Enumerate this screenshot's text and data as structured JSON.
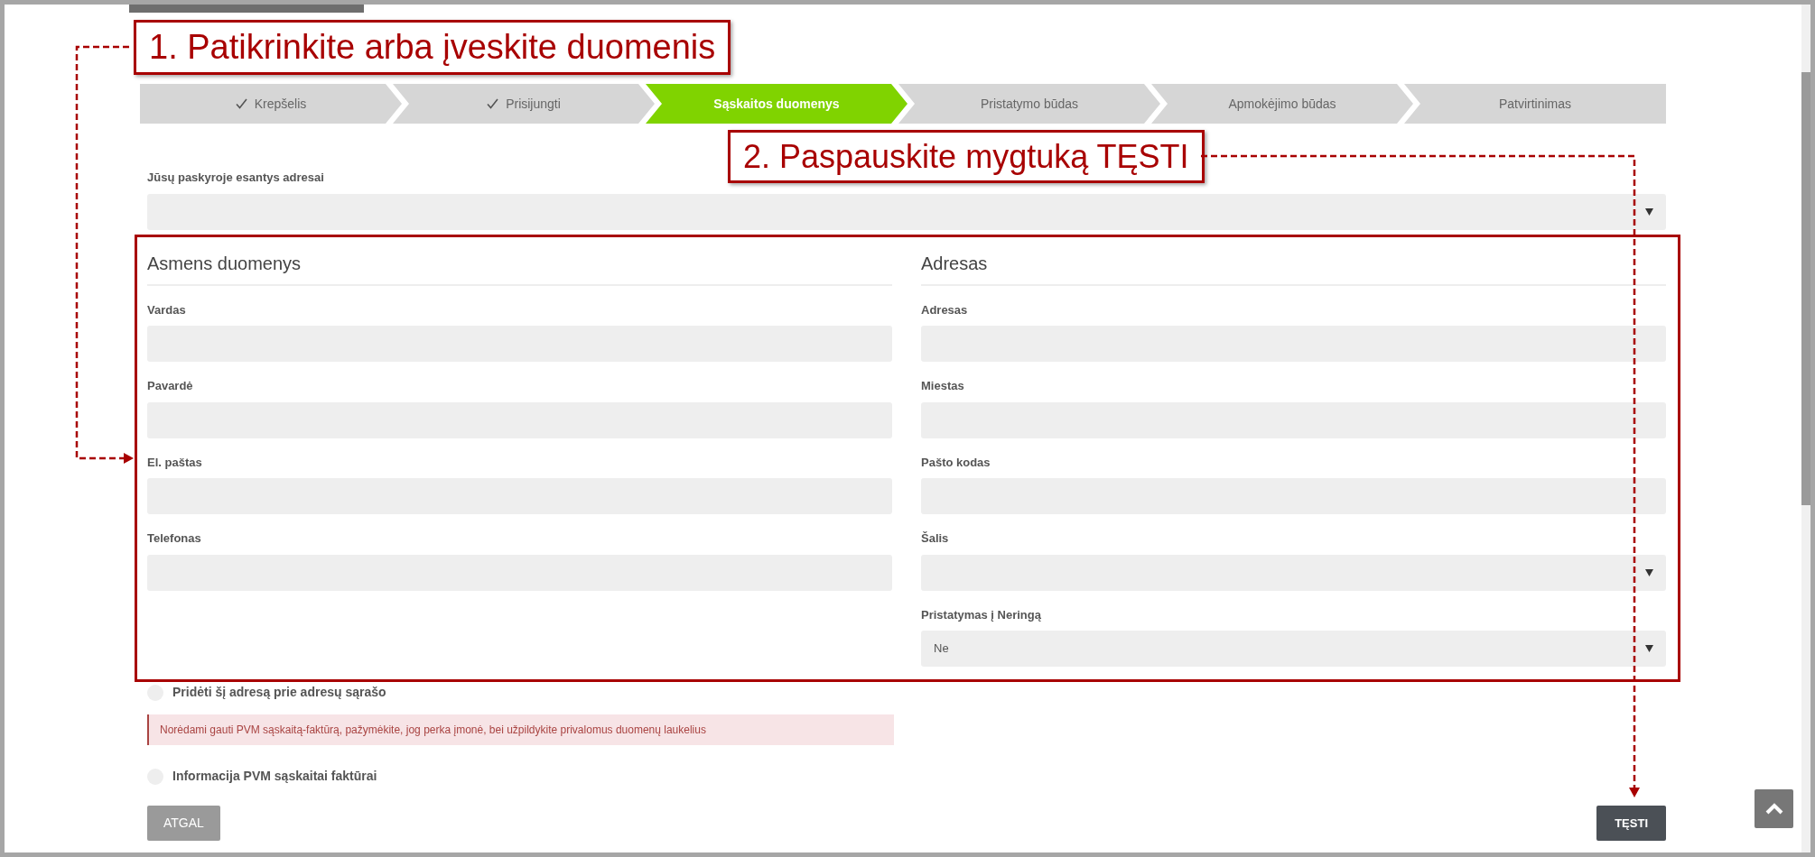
{
  "annotations": [
    {
      "text": "1. Patikrinkite arba įveskite duomenis"
    },
    {
      "text": "2. Paspauskite mygtuką TĘSTI"
    }
  ],
  "steps": [
    {
      "label": "Krepšelis",
      "done": true,
      "selected": false
    },
    {
      "label": "Prisijungti",
      "done": true,
      "selected": false
    },
    {
      "label": "Sąskaitos duomenys",
      "done": false,
      "selected": true
    },
    {
      "label": "Pristatymo būdas",
      "done": false,
      "selected": false
    },
    {
      "label": "Apmokėjimo būdas",
      "done": false,
      "selected": false
    },
    {
      "label": "Patvirtinimas",
      "done": false,
      "selected": false
    }
  ],
  "saved_addresses": {
    "label": "Jūsų paskyroje esantys adresai",
    "kind": "select"
  },
  "columns": [
    {
      "heading": "Asmens duomenys",
      "fields": [
        {
          "label": "Vardas",
          "kind": "text"
        },
        {
          "label": "Pavardė",
          "kind": "text"
        },
        {
          "label": "El. paštas",
          "kind": "text"
        },
        {
          "label": "Telefonas",
          "kind": "text"
        }
      ]
    },
    {
      "heading": "Adresas",
      "fields": [
        {
          "label": "Adresas",
          "kind": "text"
        },
        {
          "label": "Miestas",
          "kind": "text"
        },
        {
          "label": "Pašto kodas",
          "kind": "text"
        },
        {
          "label": "Šalis",
          "kind": "select"
        },
        {
          "label": "Pristatymas į Neringą",
          "kind": "select",
          "value": "Ne"
        }
      ]
    }
  ],
  "add_address": {
    "label": "Pridėti šį adresą prie adresų sąrašo",
    "checked": false
  },
  "notice": "Norėdami gauti PVM sąskaitą-faktūrą, pažymėkite, jog perka įmonė, bei užpildykite privalomus duomenų laukelius",
  "vat_info": {
    "label": "Informacija PVM sąskaitai faktūrai",
    "checked": false
  },
  "buttons": {
    "back": "ATGAL",
    "next": "TĘSTI"
  }
}
